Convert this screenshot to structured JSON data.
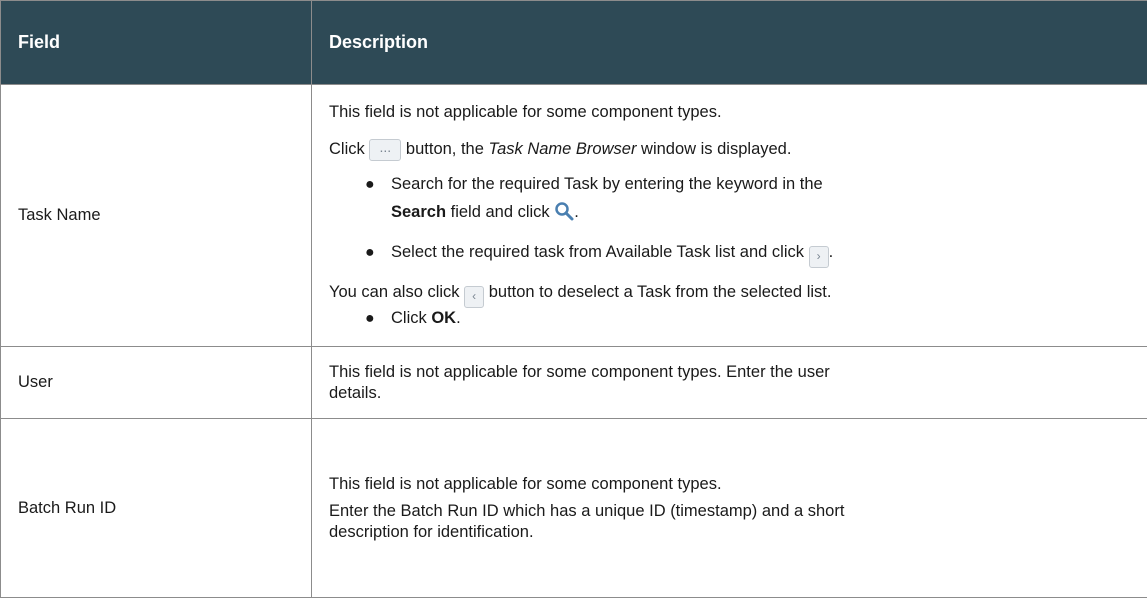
{
  "header": {
    "field": "Field",
    "description": "Description"
  },
  "rows": [
    {
      "field": "Task Name",
      "line1": "This field is not applicable for some component types.",
      "click_prefix": "Click",
      "click_middle": " button, the ",
      "click_italic": "Task Name Browser",
      "click_suffix": " window is displayed.",
      "bullet1_line1": "Search for the required Task by entering the keyword in the",
      "bullet1_bold": "Search",
      "bullet1_rest": " field and click ",
      "bullet1_end": ".",
      "bullet2_text": "Select the required task from Available Task list and click ",
      "bullet2_end": ".",
      "also_prefix": "You can also click ",
      "also_suffix": " button to deselect a Task from the selected list.",
      "bullet3_prefix": "Click ",
      "bullet3_bold": "OK",
      "bullet3_end": "."
    },
    {
      "field": "User",
      "line1": "This field is not applicable for some component types. Enter the user",
      "line2": "details."
    },
    {
      "field": "Batch Run ID",
      "line1": "This field is not applicable for some component types.",
      "line2": "Enter the Batch Run ID which has a unique ID (timestamp) and a short",
      "line3": "description for identification."
    }
  ],
  "icons": {
    "ellipsis": "...",
    "right_chevron": "›",
    "left_chevron": "‹",
    "search": "search-icon"
  }
}
